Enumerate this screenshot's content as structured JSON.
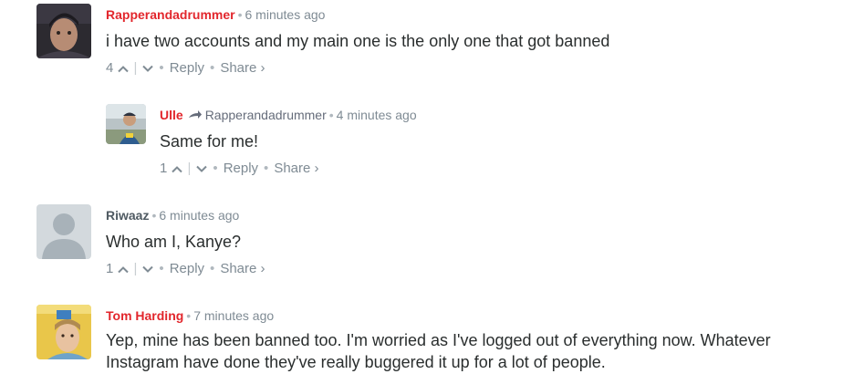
{
  "comments": [
    {
      "author": "Rapperandadrummer",
      "time": "6 minutes ago",
      "text": "i have two accounts and my main one is the only one that got banned",
      "upvotes": "4",
      "reply_label": "Reply",
      "share_label": "Share ›"
    },
    {
      "author": "Ulle",
      "reply_to": "Rapperandadrummer",
      "time": "4 minutes ago",
      "text": "Same for me!",
      "upvotes": "1",
      "reply_label": "Reply",
      "share_label": "Share ›"
    },
    {
      "author": "Riwaaz",
      "time": "6 minutes ago",
      "text": "Who am I, Kanye?",
      "upvotes": "1",
      "reply_label": "Reply",
      "share_label": "Share ›"
    },
    {
      "author": "Tom Harding",
      "time": "7 minutes ago",
      "text": "Yep, mine has been banned too. I'm worried as I've logged out of everything now. Whatever Instagram have done they've really buggered it up for a lot of people."
    }
  ],
  "separator": "•",
  "colors": {
    "author_red": "#e2262c",
    "author_gray": "#4f5a62",
    "meta_gray": "#7f8b94",
    "text": "#2a2e2e"
  }
}
